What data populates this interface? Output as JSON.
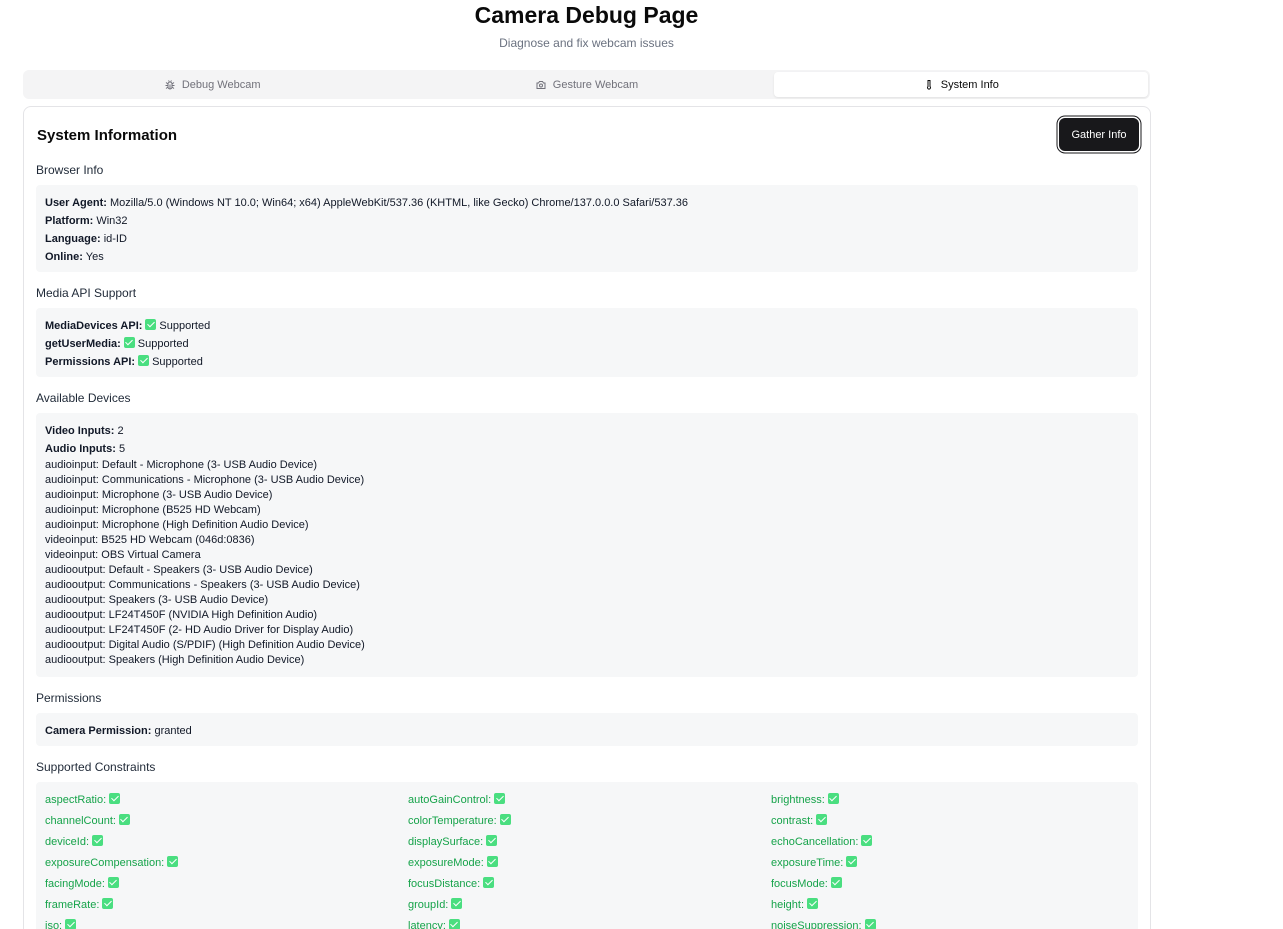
{
  "header": {
    "title": "Camera Debug Page",
    "subtitle": "Diagnose and fix webcam issues"
  },
  "tabs": [
    {
      "label": "Debug Webcam",
      "icon": "bug-icon",
      "active": false
    },
    {
      "label": "Gesture Webcam",
      "icon": "camera-icon",
      "active": false
    },
    {
      "label": "System Info",
      "icon": "thermometer-icon",
      "active": true
    }
  ],
  "card": {
    "title": "System Information",
    "gather_button": "Gather Info"
  },
  "browser_info": {
    "heading": "Browser Info",
    "user_agent_label": "User Agent:",
    "user_agent": "Mozilla/5.0 (Windows NT 10.0; Win64; x64) AppleWebKit/537.36 (KHTML, like Gecko) Chrome/137.0.0.0 Safari/537.36",
    "platform_label": "Platform:",
    "platform": "Win32",
    "language_label": "Language:",
    "language": "id-ID",
    "online_label": "Online:",
    "online": "Yes"
  },
  "media_api": {
    "heading": "Media API Support",
    "items": [
      {
        "label": "MediaDevices API:",
        "value": "Supported"
      },
      {
        "label": "getUserMedia:",
        "value": "Supported"
      },
      {
        "label": "Permissions API:",
        "value": "Supported"
      }
    ]
  },
  "devices": {
    "heading": "Available Devices",
    "video_label": "Video Inputs:",
    "video_count": "2",
    "audio_label": "Audio Inputs:",
    "audio_count": "5",
    "list": [
      "audioinput: Default - Microphone (3- USB Audio Device)",
      "audioinput: Communications - Microphone (3- USB Audio Device)",
      "audioinput: Microphone (3- USB Audio Device)",
      "audioinput: Microphone (B525 HD Webcam)",
      "audioinput: Microphone (High Definition Audio Device)",
      "videoinput: B525 HD Webcam (046d:0836)",
      "videoinput: OBS Virtual Camera",
      "audiooutput: Default - Speakers (3- USB Audio Device)",
      "audiooutput: Communications - Speakers (3- USB Audio Device)",
      "audiooutput: Speakers (3- USB Audio Device)",
      "audiooutput: LF24T450F (NVIDIA High Definition Audio)",
      "audiooutput: LF24T450F (2- HD Audio Driver for Display Audio)",
      "audiooutput: Digital Audio (S/PDIF) (High Definition Audio Device)",
      "audiooutput: Speakers (High Definition Audio Device)"
    ]
  },
  "permissions": {
    "heading": "Permissions",
    "camera_label": "Camera Permission:",
    "camera_value": "granted"
  },
  "constraints": {
    "heading": "Supported Constraints",
    "items": [
      "aspectRatio:",
      "autoGainControl:",
      "brightness:",
      "channelCount:",
      "colorTemperature:",
      "contrast:",
      "deviceId:",
      "displaySurface:",
      "echoCancellation:",
      "exposureCompensation:",
      "exposureMode:",
      "exposureTime:",
      "facingMode:",
      "focusDistance:",
      "focusMode:",
      "frameRate:",
      "groupId:",
      "height:",
      "iso:",
      "latency:",
      "noiseSuppression:"
    ]
  },
  "colors": {
    "supported_green": "#4ade80",
    "constraint_text": "#16a34a",
    "button_bg": "#18181b"
  }
}
